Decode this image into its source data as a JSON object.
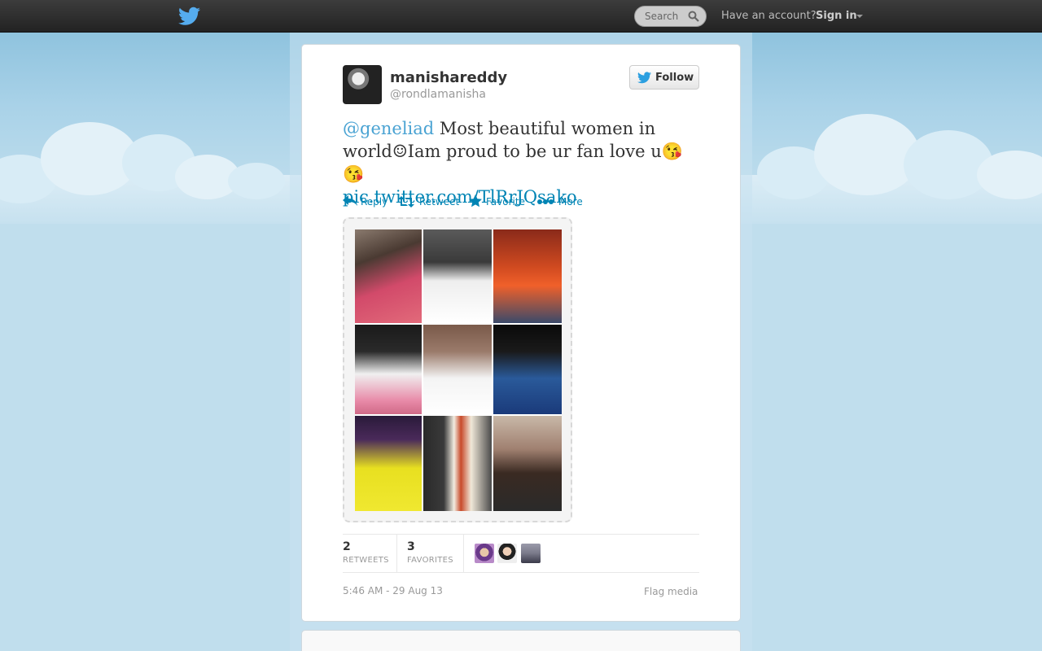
{
  "header": {
    "search_placeholder": "Search",
    "have_account": "Have an account?",
    "sign_in": "Sign in"
  },
  "tweet": {
    "display_name": "manishareddy",
    "screen_name": "@rondlamanisha",
    "follow_label": "Follow",
    "mention": "@geneliad",
    "text_1": " Most beautiful women in world",
    "text_2": "Iam proud to be ur fan love u",
    "link": "pic.twitter.com/TlRrJQsako",
    "emoji_smile": "☺",
    "emoji_kiss": "😘"
  },
  "actions": {
    "reply": "Reply",
    "retweet": "Retweet",
    "favorite": "Favorite",
    "more": "More"
  },
  "stats": {
    "retweets_count": "2",
    "retweets_label": "RETWEETS",
    "favorites_count": "3",
    "favorites_label": "FAVORITES"
  },
  "footer": {
    "timestamp": "5:46 AM - 29 Aug 13",
    "flag_media": "Flag media"
  },
  "colors": {
    "link": "#0084b4",
    "mention": "#4aa3d3",
    "background": "#c0deed",
    "topbar": "#2d2d2d"
  }
}
